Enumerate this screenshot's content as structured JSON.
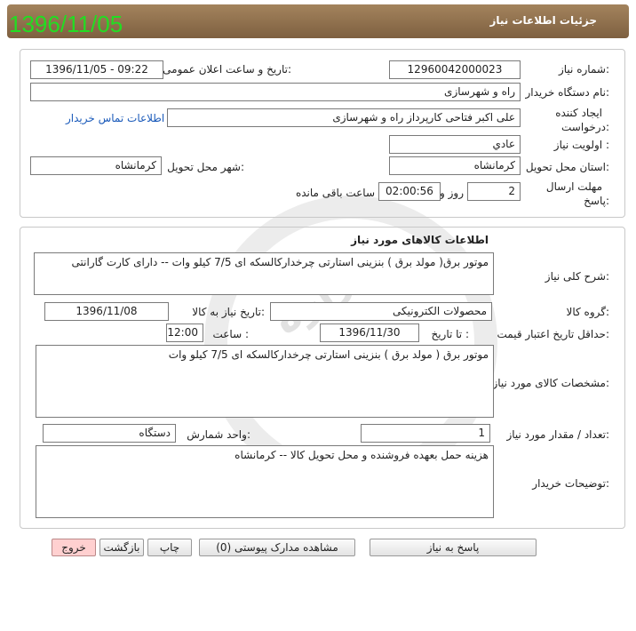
{
  "stamp_date": "1396/11/05",
  "header": {
    "title": "جزئیات اطلاعات نیاز"
  },
  "general": {
    "need_number_label": "شماره نیاز:",
    "need_number": "12960042000023",
    "announce_label": "تاریخ و ساعت اعلان عمومی:",
    "announce_value": "1396/11/05 - 09:22",
    "buyer_org_label": "نام دستگاه خریدار:",
    "buyer_org": "راه و شهرسازی",
    "creator_label_1": "ایجاد کننده",
    "creator_label_2": "درخواست:",
    "creator": "علی اکبر فتاحی کارپرداز راه و شهرسازی",
    "contact_link": "اطلاعات تماس خریدار",
    "priority_label": "اولویت نیاز :",
    "priority": "عادي",
    "province_label": "استان محل تحویل:",
    "province": "کرمانشاه",
    "city_label": "شهر محل تحویل:",
    "city": "کرمانشاه",
    "deadline_label_1": "مهلت ارسال",
    "deadline_label_2": "پاسخ:",
    "deadline_days": "2",
    "days_label": "روز و",
    "deadline_time": "02:00:56",
    "remaining_label": "ساعت باقی مانده"
  },
  "goods": {
    "section_title": "اطلاعات کالاهای مورد نیاز",
    "summary_label": "شرح کلی نیاز:",
    "summary": "موتور برق( مولد برق )  بنزینی استارتی  چرخدارکالسکه ای 7/5 کیلو وات   -- دارای کارت گارانتی",
    "group_label": "گروه کالا:",
    "group": "محصولات الکترونیکی",
    "need_date_label": "تاریخ نیاز به کالا:",
    "need_date": "1396/11/08",
    "min_valid_label": "حداقل تاریخ اعتبار قیمت:",
    "until_date_label": "تا تاریخ :",
    "until_date": "1396/11/30",
    "time_label": "ساعت :",
    "time": "12:00",
    "specs_label": "مشخصات کالای مورد نیاز:",
    "specs": "موتور برق  ( مولد برق ) بنزینی استارتی  چرخدارکالسکه ای 7/5 کیلو وات",
    "qty_label": "تعداد / مقدار مورد نیاز:",
    "qty": "1",
    "unit_label": "واحد شمارش:",
    "unit": "دستگاه",
    "buyer_notes_label": "توضیحات خریدار:",
    "buyer_notes": "هزینه حمل بعهده فروشنده و محل تحویل کالا -- کرمانشاه"
  },
  "buttons": {
    "reply": "پاسخ به نیاز",
    "attachments": "مشاهده مدارک پیوستی (0)",
    "print": "چاپ",
    "back": "بازگشت",
    "exit": "خروج"
  }
}
